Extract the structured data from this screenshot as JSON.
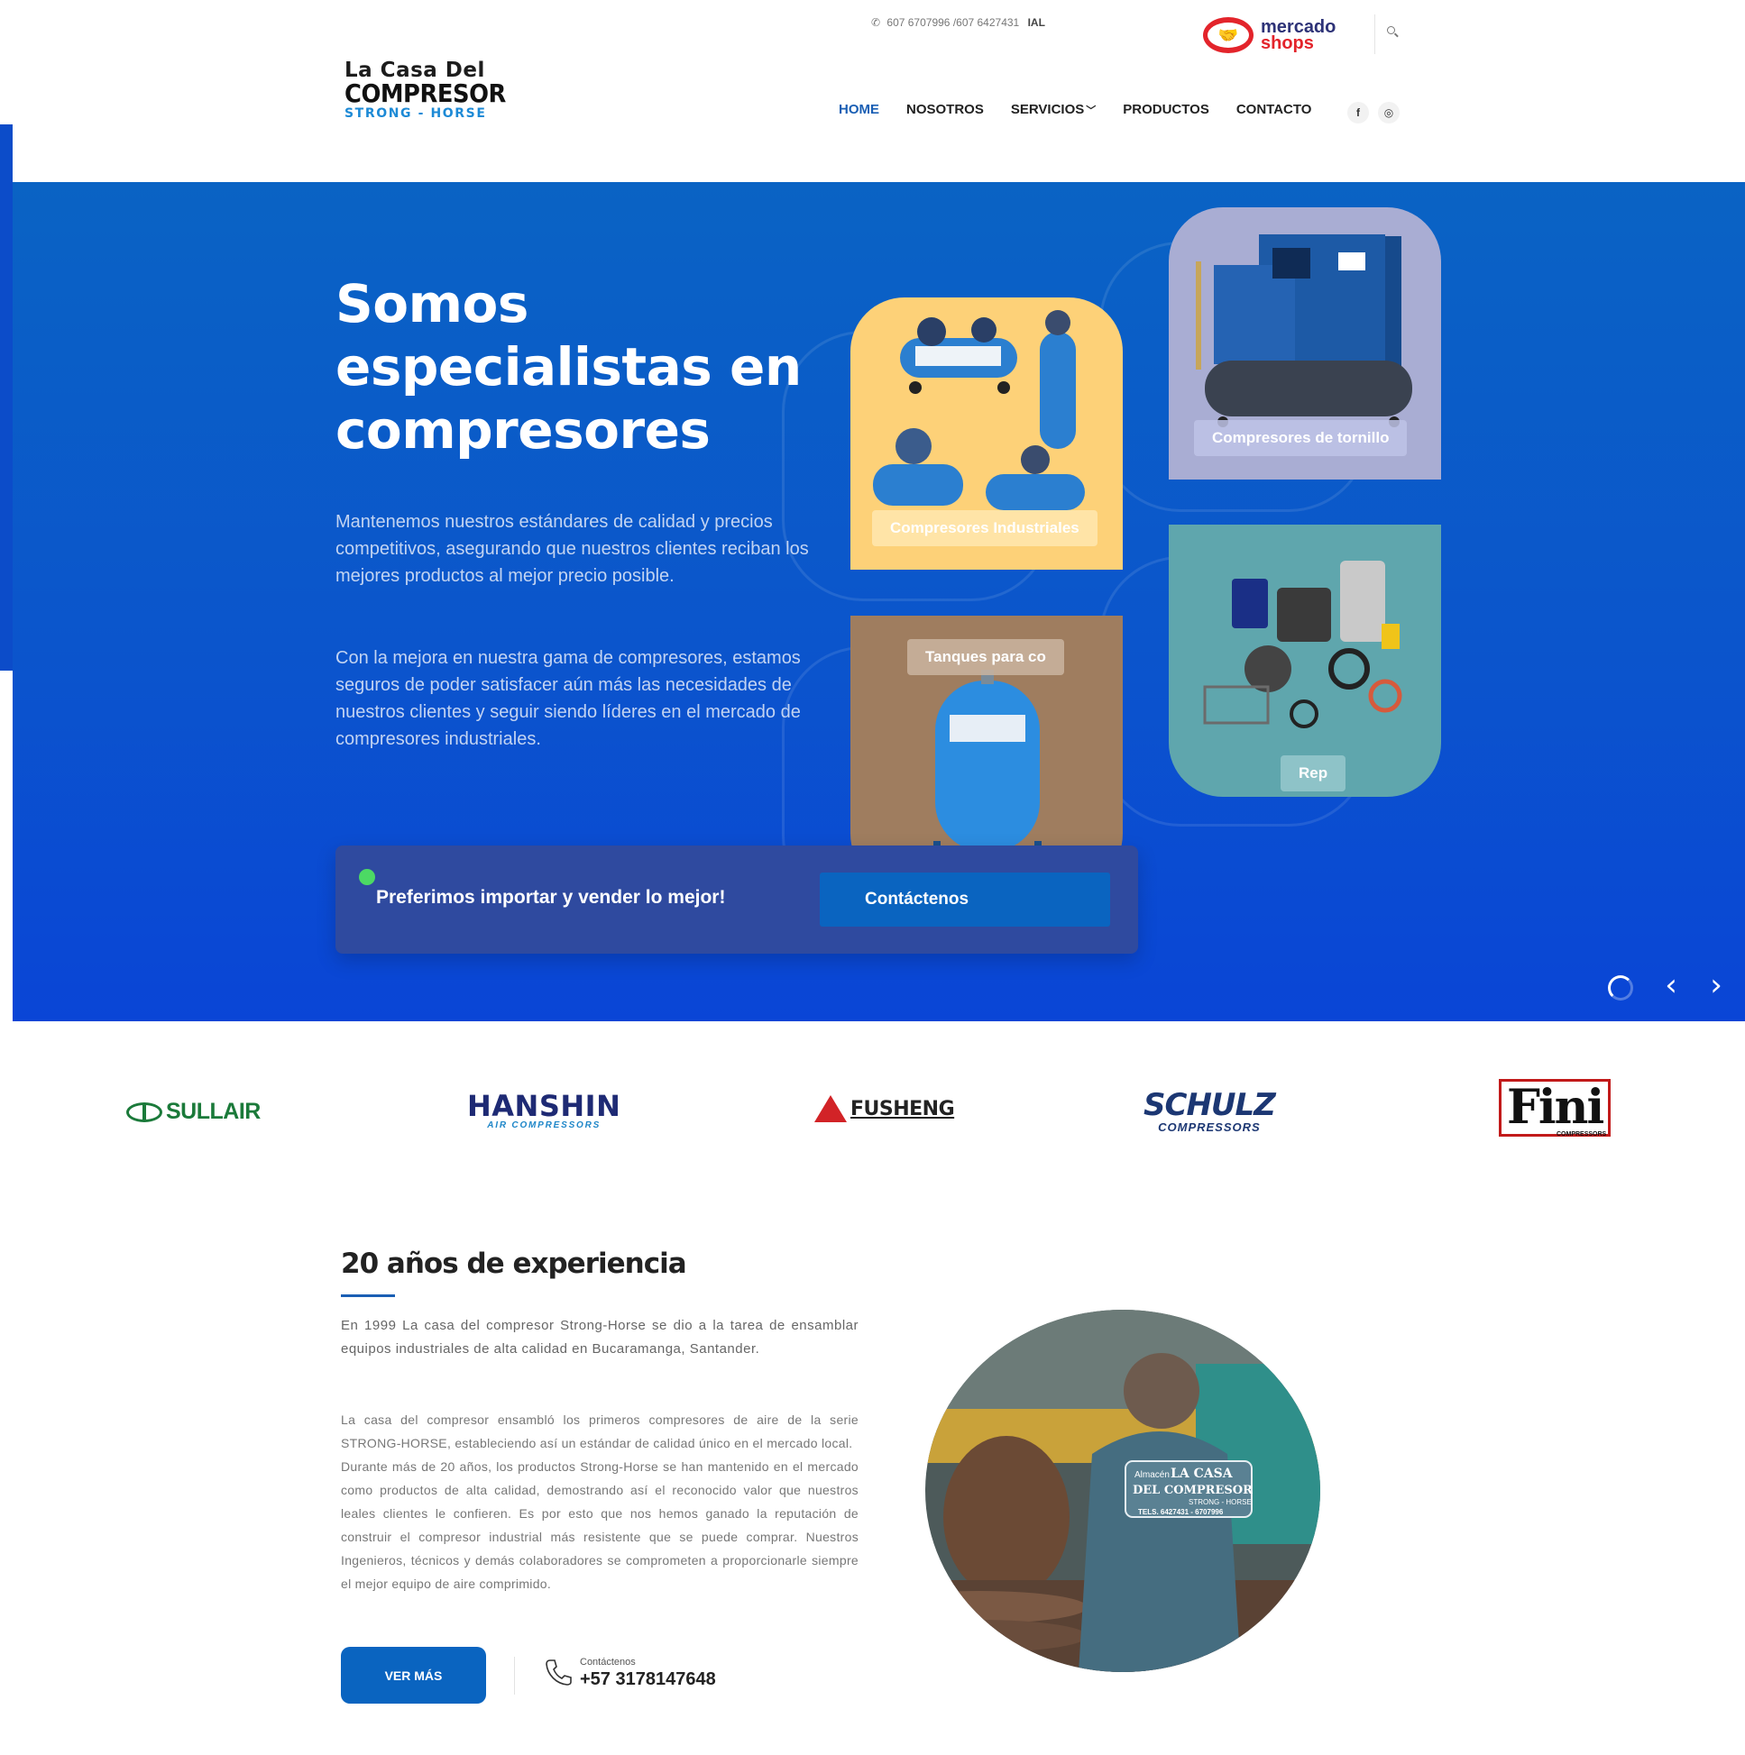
{
  "header": {
    "phone": "607 6707996 /607 6427431",
    "phone_suffix": "IAL",
    "marketplace": {
      "line1": "mercado",
      "line2": "shops"
    },
    "logo": {
      "line1": "La Casa Del",
      "line2": "COMPRESOR",
      "line3": "STRONG - HORSE"
    },
    "search_icon": "search-icon",
    "nav": {
      "home": "HOME",
      "nosotros": "NOSOTROS",
      "servicios": "SERVICIOS",
      "productos": "PRODUCTOS",
      "contacto": "CONTACTO"
    },
    "social": {
      "facebook": "f",
      "instagram": "◎"
    }
  },
  "hero": {
    "title": "Somos especialistas en compresores",
    "paragraph1": "Mantenemos nuestros estándares de calidad y precios competitivos, asegurando que nuestros clientes reciban los mejores productos al mejor precio posible.",
    "paragraph2": "Con la mejora en nuestra gama de compresores, estamos seguros de poder satisfacer aún más las necesidades de nuestros clientes y seguir siendo líderes en el mercado de compresores industriales.",
    "cards": {
      "industriales": "Compresores Industriales",
      "tornillo": "Compresores de tornillo",
      "tanques": "Tanques para co",
      "repuestos": "Rep"
    },
    "callout_text": "Preferimos importar y vender lo mejor!",
    "callout_button": "Contáctenos",
    "prev_arrow": "‹",
    "next_arrow": "›"
  },
  "brands": {
    "sullair": "SULLAIR",
    "hanshin_main": "HANSHIN",
    "hanshin_sub": "AIR COMPRESSORS",
    "fusheng": "FUSHENG",
    "schulz_main": "SCHULZ",
    "schulz_sub": "COMPRESSORS",
    "fini_main": "Fini",
    "fini_sub": "COMPRESSORS"
  },
  "about": {
    "title": "20 años de experiencia",
    "lead": "En 1999 La casa del compresor Strong-Horse se dio a la tarea de ensamblar equipos industriales de alta calidad en Bucaramanga, Santander.",
    "body1": "La casa del compresor ensambló los primeros compresores de aire de la serie STRONG-HORSE, estableciendo así un estándar de calidad único en el mercado local.",
    "body2": "Durante más de 20 años, los productos Strong-Horse se han mantenido en el mercado como productos de alta calidad, demostrando así el reconocido valor que nuestros leales clientes le confieren. Es por esto que nos hemos ganado la reputación de construir el compresor industrial más resistente que se puede comprar. Nuestros Ingenieros, técnicos y demás colaboradores se comprometen a proporcionarle siempre el mejor equipo de aire comprimido.",
    "button": "VER MÁS",
    "contact_label": "Contáctenos",
    "contact_number": "+57 3178147648",
    "jacket_text": {
      "line0": "Almacén",
      "line1": "LA CASA",
      "line2": "DEL COMPRESOR",
      "line3": "STRONG - HORSE",
      "line4": "TELS. 6427431 - 6707996"
    }
  },
  "colors": {
    "primary": "#0a64c0",
    "hero_top": "#0a63c4",
    "hero_bottom": "#0a45d6",
    "nav_active": "#1a5fb4",
    "callout_bg": "#2f4a9f",
    "status_dot": "#4cd964"
  }
}
